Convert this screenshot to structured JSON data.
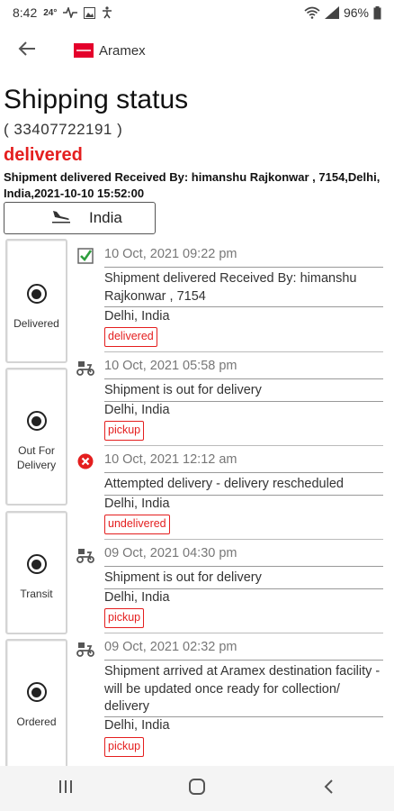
{
  "status_bar": {
    "time": "8:42",
    "temperature": "24°",
    "battery": "96%"
  },
  "app": {
    "name": "Aramex",
    "brand_color": "#e4002b"
  },
  "header": {
    "title": "Shipping status",
    "tracking_number": "( 33407722191 )",
    "status": "delivered",
    "status_detail": "Shipment delivered   Received By: himanshu Rajkonwar , 7154,Delhi, India,2021-10-10 15:52:00",
    "destination": "India"
  },
  "colors": {
    "accent_red": "#e41e1e",
    "check_green": "#2e9e3e"
  },
  "steps": [
    {
      "label": "Delivered"
    },
    {
      "label": "Out For Delivery"
    },
    {
      "label": "Transit"
    },
    {
      "label": "Ordered"
    }
  ],
  "events": [
    {
      "icon": "checkbox-checked-icon",
      "date": "10 Oct, 2021 09:22 pm",
      "description": "Shipment delivered   Received By: himanshu Rajkonwar , 7154",
      "location": "Delhi, India",
      "tag": "delivered"
    },
    {
      "icon": "delivery-scooter-icon",
      "date": "10 Oct, 2021 05:58 pm",
      "description": "Shipment is out for delivery",
      "location": "Delhi, India",
      "tag": "pickup"
    },
    {
      "icon": "error-x-icon",
      "date": "10 Oct, 2021 12:12 am",
      "description": "Attempted delivery - delivery rescheduled",
      "location": "Delhi, India",
      "tag": "undelivered"
    },
    {
      "icon": "delivery-scooter-icon",
      "date": "09 Oct, 2021 04:30 pm",
      "description": "Shipment is out for delivery",
      "location": "Delhi, India",
      "tag": "pickup"
    },
    {
      "icon": "delivery-scooter-icon",
      "date": "09 Oct, 2021 02:32 pm",
      "description": "Shipment arrived at Aramex destination facility - will be updated once ready for collection/ delivery",
      "location": "Delhi, India",
      "tag": "pickup"
    }
  ]
}
